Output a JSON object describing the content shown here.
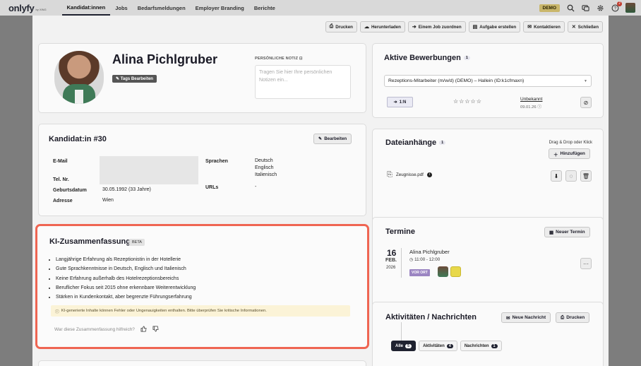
{
  "nav": {
    "logo": "onlyfy",
    "logo_sub": "by XING",
    "links": [
      "Kandidat:innen",
      "Jobs",
      "Bedarfsmeldungen",
      "Employer Branding",
      "Berichte"
    ],
    "demo": "DEMO",
    "help_badge": "2"
  },
  "toolbar": {
    "print": "Drucken",
    "download": "Herunterladen",
    "assign": "Einem Job zuordnen",
    "task": "Aufgabe erstellen",
    "contact": "Kontaktieren",
    "close": "Schließen"
  },
  "profile": {
    "name": "Alina Pichlgruber",
    "tag_button": "Tags Bearbeiten",
    "note_label": "PERSÖNLICHE NOTIZ",
    "note_placeholder": "Tragen Sie hier Ihre persönlichen Notizen ein..."
  },
  "candidate": {
    "title": "Kandidat:in #30",
    "edit": "Bearbeiten",
    "email_label": "E-Mail",
    "tel_label": "Tel. Nr.",
    "birth_label": "Geburtsdatum",
    "birth_value": "30.05.1992 (33 Jahre)",
    "address_label": "Adresse",
    "address_value": "Wien",
    "lang_label": "Sprachen",
    "lang_1": "Deutsch",
    "lang_2": "Englisch",
    "lang_3": "Italienisch",
    "urls_label": "URLs",
    "urls_value": "-"
  },
  "ki": {
    "title": "KI-Zusammenfassung",
    "badge": "BETA",
    "points": [
      "Langjährige Erfahrung als Rezeptionistin in der Hotellerie",
      "Gute Sprachkenntnisse in Deutsch, Englisch und Italienisch",
      "Keine Erfahrung außerhalb des Hotelrezeptionsbereichs",
      "Beruflicher Fokus seit 2015 ohne erkennbare Weiterentwicklung",
      "Stärken in Kundenkontakt, aber begrenzte Führungserfahrung"
    ],
    "warning": "KI-generierte Inhalte können Fehler oder Ungenauigkeiten enthalten. Bitte überprüfen Sie kritische Informationen.",
    "feedback": "War diese Zusammenfassung hilfreich?"
  },
  "applications": {
    "title": "Aktive Bewerbungen",
    "count": "1",
    "job": "Rezeptions-Mitarbeiter (m/w/d) (DEMO) – Hallein (ID:k1cfmaxn)",
    "stage": "1:N",
    "stars": "☆☆☆☆☆",
    "status": "Unbekannt",
    "date": "09.01.26"
  },
  "files": {
    "title": "Dateianhänge",
    "count": "1",
    "drag": "Drag & Drop oder Klick",
    "add": "Hinzufügen",
    "file_name": "Zeugnisse.pdf"
  },
  "appointments": {
    "title": "Termine",
    "new": "Neuer Termin",
    "day": "16",
    "month": "FEB.",
    "year": "2026",
    "name": "Alina Pichlgruber",
    "time": "11:00 - 12:00",
    "type": "VOR ORT"
  },
  "activities": {
    "title": "Aktivitäten / Nachrichten",
    "new_message": "Neue Nachricht",
    "print": "Drucken",
    "tab_all": "Alle",
    "tab_all_n": "5",
    "tab_act": "Aktivitäten",
    "tab_act_n": "4",
    "tab_msg": "Nachrichten",
    "tab_msg_n": "1"
  }
}
